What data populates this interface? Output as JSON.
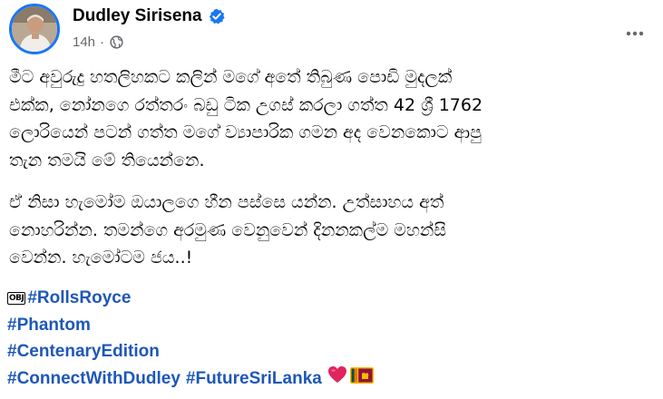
{
  "post": {
    "author": "Dudley Sirisena",
    "verified": true,
    "time": "14h",
    "meta_separator": "·",
    "audience_icon": "globe-icon",
    "more_icon": "more-horizontal-icon",
    "paragraphs": [
      {
        "lines": [
          "මීට අවුරුදු හතලිහකට කලින් මගේ අතේ තිබුණ පොඩි මුදලක්",
          "එක්ක, නෝනගෙ රත්තරං බඩු ටික උගස් කරලා ගත්ත 42 ශ්‍රී 1762",
          "ලොරියෙන් පටන් ගත්ත මගේ ව්‍යාපාරික ගමන අද වෙනකොට ආපු",
          "තැන තමයි මේ තියෙන්නෙ."
        ]
      },
      {
        "lines": [
          "ඒ නිසා හැමෝම ඔයාලගෙ හීන පස්සෙ යන්න. උත්සාහය අත්",
          "නොහරින්න. තමන්ගෙ අරමුණ වෙනුවෙන් දිනනකල්ම මහන්සි",
          "වෙන්න. හැමෝටම ජය..!"
        ]
      }
    ],
    "obj_placeholder": "OBJ",
    "hashtags": {
      "line1": "#RollsRoyce",
      "line2": "#Phantom",
      "line3": "#CentenaryEdition",
      "line4a": "#ConnectWithDudley",
      "line4b": "#FutureSriLanka"
    },
    "emojis": [
      "heart-emoji",
      "sri-lanka-flag-emoji"
    ],
    "colors": {
      "hashtag": "#1e57b8",
      "verified": "#1877f2",
      "meta": "#65676b",
      "heart": "#e0245e"
    }
  }
}
